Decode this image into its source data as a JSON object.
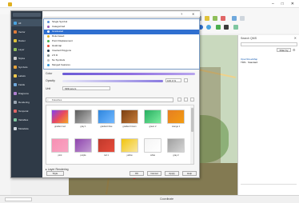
{
  "colors": {
    "dialog_sidebar": "#2f3a47",
    "accent_selection": "#2f6fd0",
    "map_base": "#c9d9be",
    "link": "#1a5fb4"
  },
  "dialog_sidebar": {
    "items": [
      {
        "icon": "globe-icon",
        "label": "All",
        "color": "#4aa3df"
      },
      {
        "icon": "layers-icon",
        "label": "Vector",
        "color": "#e07b39"
      },
      {
        "icon": "pencil-icon",
        "label": "Raster",
        "color": "#e0c23a"
      },
      {
        "icon": "list-icon",
        "label": "Layer",
        "color": "#8fbf5a"
      },
      {
        "icon": "cube-icon",
        "label": "Styles",
        "color": "#c9c9c9"
      },
      {
        "icon": "folder-icon",
        "label": "Symbols",
        "color": "#e8a33a"
      },
      {
        "icon": "star-icon",
        "label": "Labels",
        "color": "#f2c94c"
      },
      {
        "icon": "grid-icon",
        "label": "Fields",
        "color": "#6fa8dc"
      },
      {
        "icon": "chart-icon",
        "label": "Diagrams",
        "color": "#b07fd0"
      },
      {
        "icon": "tools-icon",
        "label": "Rendering",
        "color": "#9aa5b1"
      },
      {
        "icon": "clock-icon",
        "label": "Temporal",
        "color": "#e06666"
      },
      {
        "icon": "code-icon",
        "label": "Variables",
        "color": "#7fc7a0"
      },
      {
        "icon": "info-icon",
        "label": "Metadata",
        "color": "#cfd6dd"
      }
    ]
  },
  "dropdown": {
    "items": [
      {
        "label": "Single Symbol",
        "swatch": "#5a8fd8",
        "selected": false
      },
      {
        "label": "Categorized",
        "swatch": "#9b59b6",
        "selected": false
      },
      {
        "label": "Graduated",
        "swatch": "#ffffff",
        "selected": true
      },
      {
        "label": "Rule-based",
        "swatch": "#e0b020",
        "selected": false
      },
      {
        "label": "Point Displacement",
        "swatch": "#4caf50",
        "selected": false
      },
      {
        "label": "Heatmap",
        "swatch": "#e74c3c",
        "selected": false
      },
      {
        "label": "Inverted Polygons",
        "swatch": "#2c3e50",
        "selected": false
      },
      {
        "label": "2.5 D",
        "swatch": "#7f8c8d",
        "selected": false
      },
      {
        "label": "No Symbols",
        "swatch": "#bdbdbd",
        "selected": false
      },
      {
        "label": "Merged Features",
        "swatch": "#3498db",
        "selected": false
      }
    ]
  },
  "symbol": {
    "color_label": "Color",
    "opacity_label": "Opacity",
    "opacity_value": "100.0 %",
    "unit_label": "Unit",
    "unit_value": "Millimeters",
    "search_placeholder": "Favorites"
  },
  "palettes": [
    {
      "name": "gradient red",
      "gradient": "linear-gradient(135deg,#7e3ff2,#e84a5f,#f5a623)"
    },
    {
      "name": "gray 1",
      "gradient": "linear-gradient(135deg,#5b5b5b,#bdbdbd)"
    },
    {
      "name": "gradient blue",
      "gradient": "linear-gradient(135deg,#2e86de,#74b9ff)"
    },
    {
      "name": "gradient brown",
      "gradient": "linear-gradient(135deg,#7b3f12,#c77d3a)"
    },
    {
      "name": "green 2",
      "gradient": "linear-gradient(135deg,#27ae60,#7bed9f)"
    },
    {
      "name": "orange 1",
      "gradient": "linear-gradient(135deg,#e67e22,#f39c12)"
    },
    {
      "name": "pink",
      "gradient": "linear-gradient(135deg,#f78fb3,#f8a5c2)"
    },
    {
      "name": "purple",
      "gradient": "linear-gradient(135deg,#8e44ad,#c39bd3)"
    },
    {
      "name": "red 1",
      "gradient": "linear-gradient(135deg,#c0392b,#e74c3c)"
    },
    {
      "name": "yellow",
      "gradient": "linear-gradient(135deg,#f1c40f,#f9e79f)"
    },
    {
      "name": "white",
      "gradient": "linear-gradient(135deg,#f5f5f5,#ffffff)"
    },
    {
      "name": "gray 2",
      "gradient": "linear-gradient(135deg,#a0a0a0,#d5d5d5)"
    }
  ],
  "footer": {
    "layer_rendering": "Layer Rendering",
    "buttons": [
      "Style",
      "OK",
      "Cancel",
      "Apply",
      "Help"
    ]
  },
  "right_panel": {
    "title": "Search QMS",
    "add_button": "Filter by",
    "result_name": "OpenStreetMap",
    "result_detail": "TMS · Standard"
  },
  "statusbar": {
    "coordinate_label": "Coordinate"
  }
}
